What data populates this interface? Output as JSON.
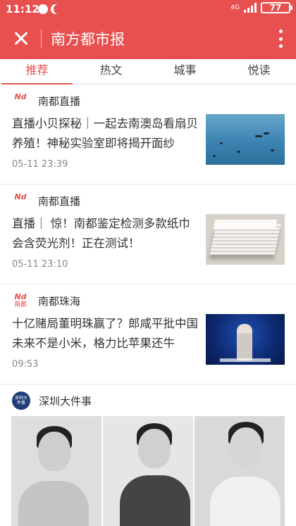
{
  "status_bar": {
    "time": "11:12",
    "network": "4G",
    "battery": "77"
  },
  "app_bar": {
    "title": "南方都市报"
  },
  "tabs": [
    {
      "label": "推荐",
      "active": true
    },
    {
      "label": "热文",
      "active": false
    },
    {
      "label": "城事",
      "active": false
    },
    {
      "label": "悦读",
      "active": false
    }
  ],
  "feed": [
    {
      "source": "南都直播",
      "logo_text": "Nd",
      "title": "直播小贝探秘｜一起去南澳岛看扇贝养殖！神秘实验室即将揭开面纱",
      "time": "05-11 23:39",
      "thumb": "sea"
    },
    {
      "source": "南都直播",
      "logo_text": "Nd",
      "title": "直播｜   惊！南都鉴定检测多款纸巾会含荧光剂！正在测试！",
      "time": "05-11 23:10",
      "thumb": "tissue"
    },
    {
      "source": "南都珠海",
      "logo_text": "Nd",
      "logo_sub": "南都",
      "title": "十亿赌局董明珠赢了？郎咸平批中国未来不是小米，格力比苹果还牛",
      "time": "09:53",
      "thumb": "stage"
    }
  ],
  "big_item": {
    "source": "深圳大件事",
    "logo_text": "深圳大件事"
  },
  "colors": {
    "brand": "#e8504f",
    "active_tab": "#e8504f"
  }
}
